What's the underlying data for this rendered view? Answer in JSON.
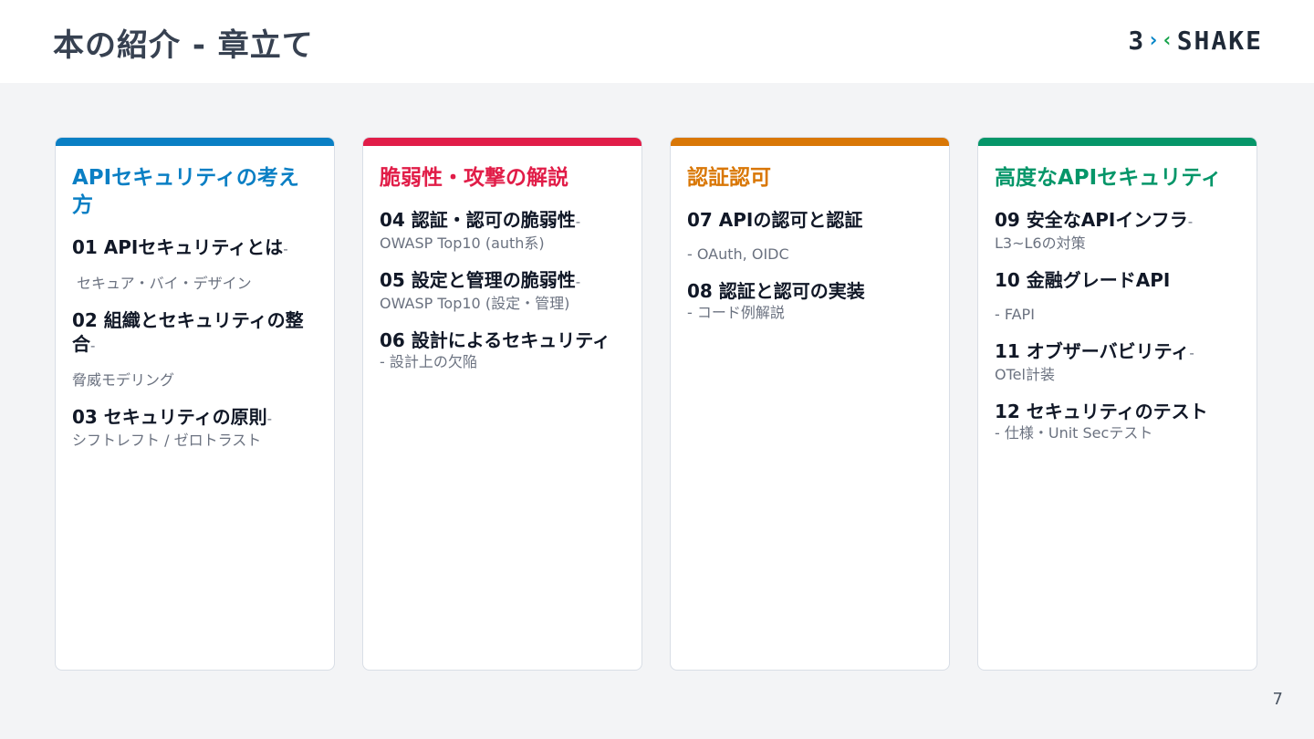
{
  "header": {
    "title": "本の紹介 - 章立て",
    "logo": {
      "left": "3",
      "right": "SHAKE"
    }
  },
  "page_number": "7",
  "colors": {
    "blue": "#0a7fc4",
    "red": "#e11d48",
    "orange": "#d97706",
    "green": "#059669"
  },
  "columns": [
    {
      "title": "APIセキュリティの考え方",
      "color": "#0a7fc4",
      "items": [
        {
          "head": "01 APIセキュリティとは",
          "dash": "-",
          "sub": "セキュア・バイ・デザイン"
        },
        {
          "head": "02 組織とセキュリティの整合",
          "dash": "-",
          "sub": "脅威モデリング"
        },
        {
          "head": "03 セキュリティの原則",
          "dash": "-",
          "sub": "シフトレフト / ゼロトラスト"
        }
      ]
    },
    {
      "title": "脆弱性・攻撃の解説",
      "color": "#e11d48",
      "items": [
        {
          "head": "04 認証・認可の脆弱性",
          "dash": "-",
          "sub": "OWASP Top10 (auth系)"
        },
        {
          "head": "05 設定と管理の脆弱性",
          "dash": "-",
          "sub": "OWASP Top10 (設定・管理)"
        },
        {
          "head": "06 設計によるセキュリティ",
          "dash": "",
          "sub": "- 設計上の欠陥"
        }
      ]
    },
    {
      "title": "認証認可",
      "color": "#d97706",
      "items": [
        {
          "head": "07 APIの認可と認証",
          "dash": "",
          "sub": "- OAuth, OIDC"
        },
        {
          "head": "08 認証と認可の実装",
          "dash": "",
          "sub": "- コード例解説"
        }
      ]
    },
    {
      "title": "高度なAPIセキュリティ",
      "color": "#059669",
      "items": [
        {
          "head": "09 安全なAPIインフラ",
          "dash": "-",
          "sub": "L3~L6の対策"
        },
        {
          "head": "10 金融グレードAPI",
          "dash": "",
          "sub": "- FAPI"
        },
        {
          "head": "11 オブザーバビリティ",
          "dash": "-",
          "sub": "OTel計装"
        },
        {
          "head": "12 セキュリティのテスト",
          "dash": "",
          "sub": "- 仕様・Unit Secテスト"
        }
      ]
    }
  ]
}
